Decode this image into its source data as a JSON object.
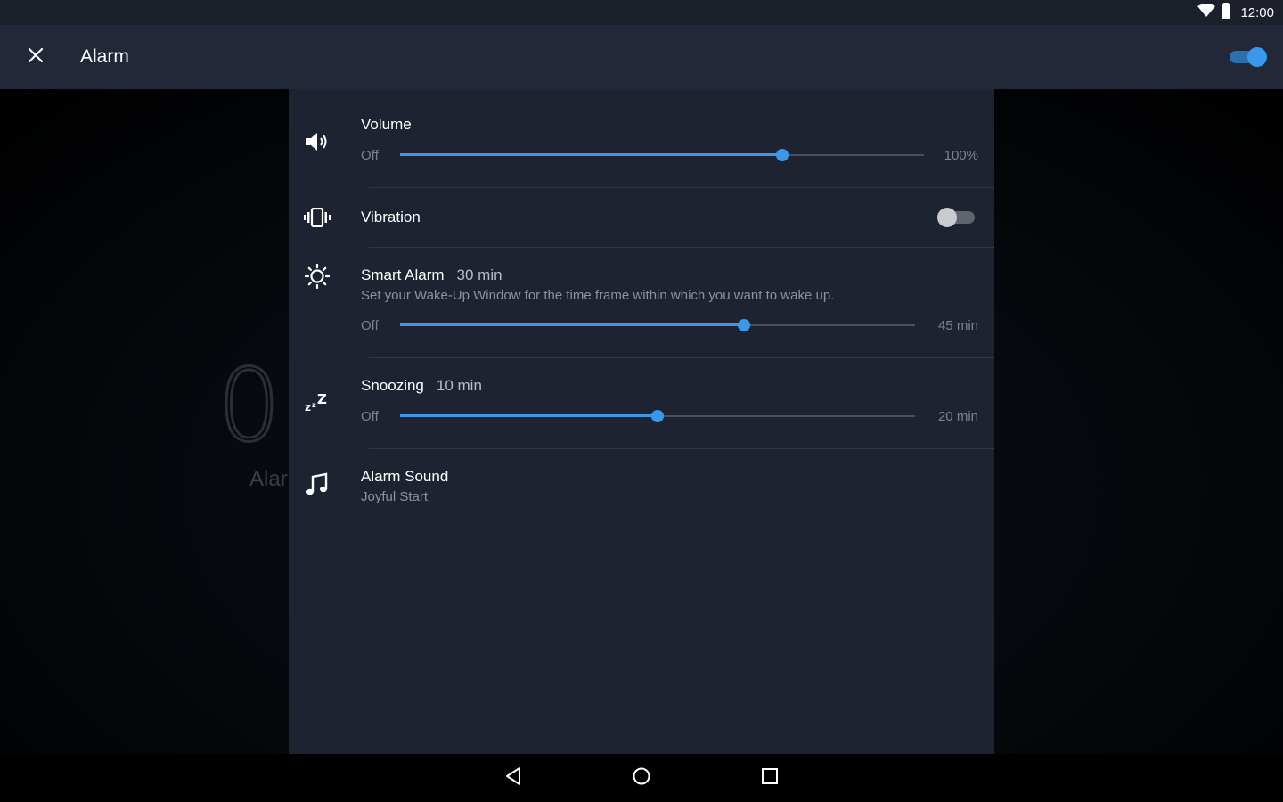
{
  "status_bar": {
    "time": "12:00",
    "icons": [
      "wifi-icon",
      "battery-icon"
    ]
  },
  "app_bar": {
    "title": "Alarm",
    "close_icon": "close-icon",
    "enabled": true
  },
  "background": {
    "time_fragment": "0",
    "label_fragment": "Alar"
  },
  "settings": {
    "volume": {
      "title": "Volume",
      "min_label": "Off",
      "max_label": "100%",
      "level_fraction": 0.73,
      "icon": "speaker-icon"
    },
    "vibration": {
      "title": "Vibration",
      "enabled": false,
      "icon": "vibration-icon"
    },
    "smart_alarm": {
      "title": "Smart Alarm",
      "value": "30 min",
      "description": "Set your Wake-Up Window for the time frame within which you want to wake up.",
      "min_label": "Off",
      "max_label": "45 min",
      "level_fraction": 0.667,
      "icon": "sun-icon"
    },
    "snoozing": {
      "title": "Snoozing",
      "value": "10 min",
      "min_label": "Off",
      "max_label": "20 min",
      "level_fraction": 0.5,
      "icon": "zzz-icon"
    },
    "alarm_sound": {
      "title": "Alarm Sound",
      "value": "Joyful Start",
      "icon": "music-note-icon"
    }
  },
  "nav_bar": {
    "buttons": [
      "back-icon",
      "home-icon",
      "recents-icon"
    ]
  },
  "colors": {
    "accent": "#3a98ea",
    "sheet": "#1d2330",
    "app_bar": "#222837"
  }
}
